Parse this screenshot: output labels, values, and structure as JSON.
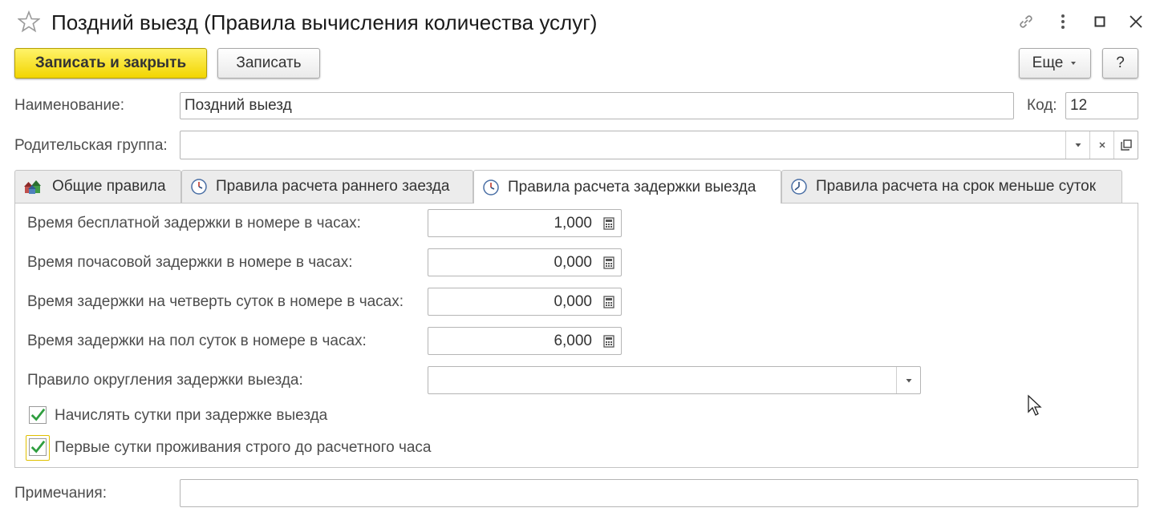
{
  "window": {
    "title": "Поздний выезд (Правила вычисления количества услуг)"
  },
  "toolbar": {
    "save_close_label": "Записать и закрыть",
    "save_label": "Записать",
    "more_label": "Еще",
    "help_label": "?"
  },
  "form": {
    "name_label": "Наименование:",
    "name_value": "Поздний выезд",
    "code_label": "Код:",
    "code_value": "12",
    "parent_label": "Родительская группа:",
    "parent_value": "",
    "notes_label": "Примечания:",
    "notes_value": ""
  },
  "tabs": [
    {
      "label": "Общие правила",
      "icon": "houses-icon"
    },
    {
      "label": "Правила расчета раннего заезда",
      "icon": "clock-icon"
    },
    {
      "label": "Правила расчета задержки выезда",
      "icon": "clock-icon"
    },
    {
      "label": "Правила расчета на срок меньше суток",
      "icon": "clock-icon"
    }
  ],
  "active_tab_index": 2,
  "late_checkout": {
    "free_delay_label": "Время бесплатной задержки в номере в часах:",
    "free_delay_value": "1,000",
    "hourly_delay_label": "Время почасовой задержки в номере в часах:",
    "hourly_delay_value": "0,000",
    "quarter_day_label": "Время задержки на четверть суток в номере в часах:",
    "quarter_day_value": "0,000",
    "half_day_label": "Время задержки на пол суток в номере в часах:",
    "half_day_value": "6,000",
    "rounding_label": "Правило округления задержки выезда:",
    "rounding_value": "",
    "charge_day_label": "Начислять сутки при задержке выезда",
    "charge_day_checked": true,
    "first_day_label": "Первые сутки проживания строго до расчетного часа",
    "first_day_checked": true
  },
  "colors": {
    "primary_button": "#f7e21a",
    "checkmark": "#2f9e3f",
    "border": "#b5b5b5"
  }
}
